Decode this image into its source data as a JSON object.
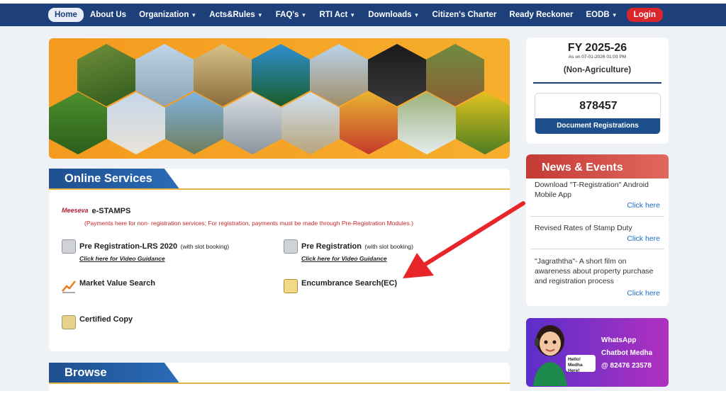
{
  "nav": {
    "home": "Home",
    "about": "About Us",
    "organization": "Organization",
    "acts": "Acts&Rules",
    "faqs": "FAQ's",
    "rti": "RTI Act",
    "downloads": "Downloads",
    "charter": "Citizen's Charter",
    "reckoner": "Ready Reckoner",
    "eodb": "EODB",
    "login": "Login"
  },
  "online_services": {
    "title": "Online Services",
    "estamps_logo": "Meeseva",
    "estamps_title": "e-STAMPS",
    "estamps_note": "(Payments here for non- registration services; For registration, payments must be made through Pre-Registration Modules.)",
    "pre_lrs_title": "Pre Registration-LRS 2020",
    "pre_lrs_note": "(with slot booking)",
    "pre_lrs_link": "Click here for Video Guidance",
    "pre_title": "Pre Registration",
    "pre_note": "(with slot booking)",
    "pre_link": "Click here for Video Guidance",
    "market_value": "Market Value Search",
    "encumbrance": "Encumbrance Search(EC)",
    "certified_copy": "Certified Copy"
  },
  "browse": {
    "title": "Browse"
  },
  "fy": {
    "title": "FY 2025-26",
    "as_of": "As on 07-01-2026 01:03 PM",
    "type": "(Non-Agriculture)",
    "count": "878457",
    "count_label": "Document Registrations"
  },
  "news": {
    "title": "News & Events",
    "items": [
      {
        "text": "Download \"T-Registration\" Android Mobile App",
        "link": "Click here"
      },
      {
        "text": "Revised Rates of Stamp Duty",
        "link": "Click here"
      },
      {
        "text": "\"Jagraththa\"- A short film on awareness about property purchase and registration process",
        "link": "Click here"
      }
    ]
  },
  "whatsapp": {
    "line1": "WhatsApp",
    "line2": "Chatbot Medha",
    "line3": "@ 82476 23578",
    "bubble": "Hello! Medha Here!"
  },
  "colors": {
    "nav_bg": "#1d3f7a",
    "banner_orange": "#f39a1f",
    "login_red": "#d9262b",
    "news_red": "#c43a34",
    "arrow_red": "#e8262a"
  }
}
